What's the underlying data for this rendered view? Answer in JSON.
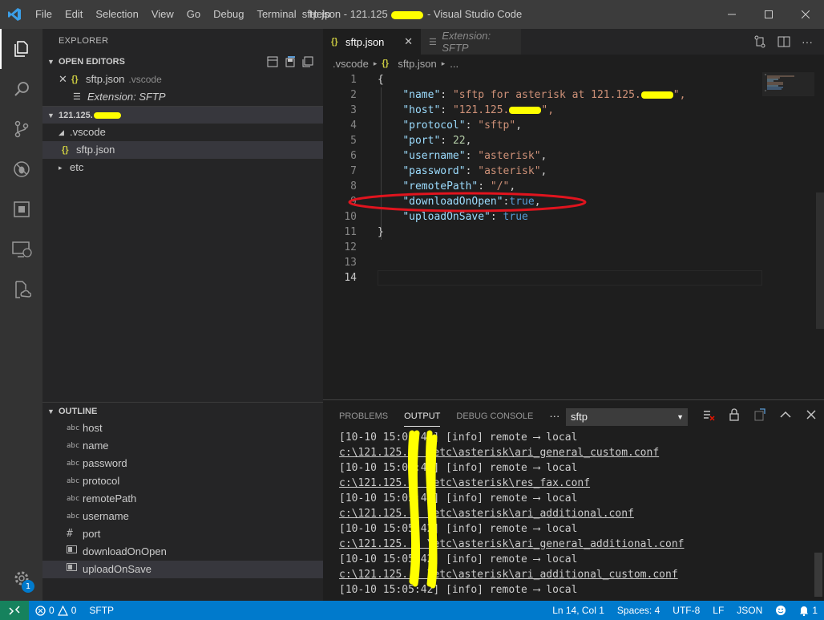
{
  "window": {
    "title": "sftp.json - 121.125",
    "title_suffix": "- Visual Studio Code"
  },
  "menu": [
    "File",
    "Edit",
    "Selection",
    "View",
    "Go",
    "Debug",
    "Terminal",
    "Help"
  ],
  "sidebar": {
    "title": "EXPLORER",
    "open_editors": {
      "header": "OPEN EDITORS",
      "items": [
        {
          "name": "sftp.json",
          "folder": ".vscode"
        },
        {
          "name": "Extension: SFTP"
        }
      ]
    },
    "workspace": {
      "header": "121.125.",
      "items": [
        {
          "name": ".vscode"
        },
        {
          "name": "sftp.json"
        },
        {
          "name": "etc"
        }
      ]
    },
    "outline": {
      "header": "OUTLINE",
      "items": [
        {
          "name": "host",
          "kind": "abc"
        },
        {
          "name": "name",
          "kind": "abc"
        },
        {
          "name": "password",
          "kind": "abc"
        },
        {
          "name": "protocol",
          "kind": "abc"
        },
        {
          "name": "remotePath",
          "kind": "abc"
        },
        {
          "name": "username",
          "kind": "abc"
        },
        {
          "name": "port",
          "kind": "#"
        },
        {
          "name": "downloadOnOpen",
          "kind": "bool"
        },
        {
          "name": "uploadOnSave",
          "kind": "bool"
        }
      ]
    }
  },
  "tabs": [
    {
      "label": "sftp.json",
      "active": true
    },
    {
      "label": "Extension: SFTP",
      "active": false
    }
  ],
  "breadcrumb": [
    ".vscode",
    "sftp.json",
    "..."
  ],
  "code": {
    "line_numbers": [
      "1",
      "2",
      "3",
      "4",
      "5",
      "6",
      "7",
      "8",
      "9",
      "10",
      "11",
      "12",
      "13",
      "14"
    ],
    "l1": "{",
    "name_key": "\"name\"",
    "name_val": "\"sftp for asterisk at 121.125.",
    "name_tail": "\",",
    "host_key": "\"host\"",
    "host_val": "\"121.125.",
    "host_tail": "\",",
    "protocol_key": "\"protocol\"",
    "protocol_val": "\"sftp\"",
    "port_key": "\"port\"",
    "port_val": "22",
    "username_key": "\"username\"",
    "username_val": "\"asterisk\"",
    "password_key": "\"password\"",
    "password_val": "\"asterisk\"",
    "remote_key": "\"remotePath\"",
    "remote_val": "\"/\"",
    "download_key": "\"downloadOnOpen\"",
    "download_val": "true",
    "upload_key": "\"uploadOnSave\"",
    "upload_val": "true",
    "l11": "}"
  },
  "panel": {
    "tabs": [
      "PROBLEMS",
      "OUTPUT",
      "DEBUG CONSOLE"
    ],
    "more": "···",
    "channel": "sftp",
    "lines": [
      "[10-10 15:05:42] [info] remote ⟶ local",
      "c:\\121.125.   \\etc\\asterisk\\ari_general_custom.conf",
      "[10-10 15:05:42] [info] remote ⟶ local",
      "c:\\121.125.   \\etc\\asterisk\\res_fax.conf",
      "[10-10 15:05:42] [info] remote ⟶ local",
      "c:\\121.125.   \\etc\\asterisk\\ari_additional.conf",
      "[10-10 15:05:42] [info] remote ⟶ local",
      "c:\\121.125.   \\etc\\asterisk\\ari_general_additional.conf",
      "[10-10 15:05:42] [info] remote ⟶ local",
      "c:\\121.125.   \\etc\\asterisk\\ari_additional_custom.conf",
      "[10-10 15:05:42] [info] remote ⟶ local"
    ]
  },
  "status": {
    "errors": "0",
    "warnings": "0",
    "sftp": "SFTP",
    "position": "Ln 14, Col 1",
    "spaces": "Spaces: 4",
    "encoding": "UTF-8",
    "eol": "LF",
    "language": "JSON",
    "notifications": "1",
    "badge": "1"
  },
  "colors": {
    "accent": "#007acc",
    "remote": "#16825d",
    "annotation_red": "#e0141e",
    "annotation_yellow": "#ffff00"
  }
}
